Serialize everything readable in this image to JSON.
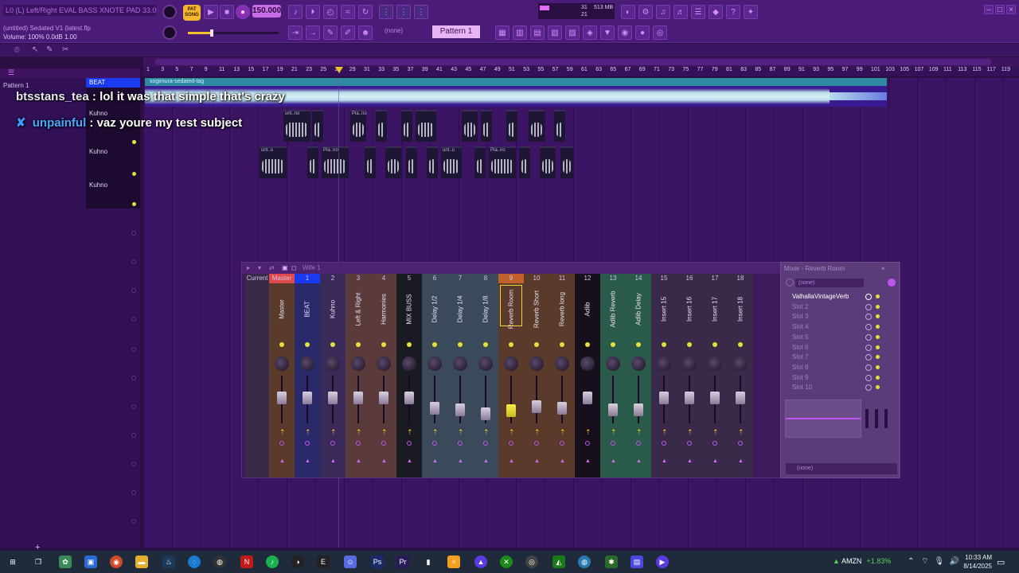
{
  "toolbar": {
    "hint": "L0 (L) Left/Right EVAL BASS XNOTE PAD 33.0",
    "song_mode": [
      "PAT",
      "SONG"
    ],
    "tempo": "150.000",
    "project_title": "(untitled) Sedated V1 (latest.flp",
    "volume_readout": "Volume: 100% 0.0dB 1.00",
    "pattern_selector": "Pattern 1",
    "channel_filter": "(none)",
    "cpu_value": "31",
    "ram_value": "513 MB",
    "second_value": "21"
  },
  "playlist": {
    "pattern_label": "Pattern 1",
    "timeline_ticks": [
      "1",
      "3",
      "5",
      "7",
      "9",
      "11",
      "13",
      "15",
      "17",
      "19",
      "21",
      "23",
      "25",
      "27",
      "29",
      "31",
      "33",
      "35",
      "37",
      "39",
      "41",
      "43",
      "45",
      "47",
      "49",
      "51",
      "53",
      "55",
      "57",
      "59",
      "61",
      "63",
      "65",
      "67",
      "69",
      "71",
      "73",
      "75",
      "77",
      "79",
      "81",
      "83",
      "85",
      "87",
      "89",
      "91",
      "93",
      "95",
      "97",
      "99",
      "101",
      "103",
      "105",
      "107",
      "109",
      "111",
      "113",
      "115",
      "117",
      "119"
    ],
    "tracks": [
      {
        "name": "BEAT"
      },
      {
        "name": "Kuhno"
      },
      {
        "name": "Kuhno"
      },
      {
        "name": "Kuhno"
      }
    ],
    "clip_main": "sogimura-sedated-tag",
    "small_clips_row1": [
      "unt..no",
      "Pia..no"
    ],
    "small_clips_row2": [
      "unt..o",
      "Pia..no",
      "unt..o",
      "Pia..no"
    ]
  },
  "chat": [
    {
      "user": "btsstans_tea",
      "message": "lol it was that simple that's crazy"
    },
    {
      "user": "unpainful",
      "message": "vaz youre my test subject"
    }
  ],
  "mixer": {
    "title": "Wife 1",
    "channels": [
      {
        "num": "Current",
        "name": "",
        "fader": 0.0
      },
      {
        "num": "Master",
        "name": "Master",
        "fader": 0.55
      },
      {
        "num": "1",
        "name": "BEAT",
        "fader": 0.55
      },
      {
        "num": "2",
        "name": "Kuhno",
        "fader": 0.55
      },
      {
        "num": "3",
        "name": "Left & Right",
        "fader": 0.55
      },
      {
        "num": "4",
        "name": "Harmonies",
        "fader": 0.55
      },
      {
        "num": "5",
        "name": "MIX BUSS",
        "fader": 0.55
      },
      {
        "num": "6",
        "name": "Delay 1/2",
        "fader": 0.25
      },
      {
        "num": "7",
        "name": "Delay 1/4",
        "fader": 0.2
      },
      {
        "num": "8",
        "name": "Delay 1/8",
        "fader": 0.1
      },
      {
        "num": "9",
        "name": "Reverb Room",
        "fader": 0.18
      },
      {
        "num": "10",
        "name": "Reverb Short",
        "fader": 0.3
      },
      {
        "num": "11",
        "name": "Reverb long",
        "fader": 0.25
      },
      {
        "num": "12",
        "name": "Adlib",
        "fader": 0.55
      },
      {
        "num": "13",
        "name": "Adlib Reverb",
        "fader": 0.2
      },
      {
        "num": "14",
        "name": "Adlib Delay",
        "fader": 0.2
      },
      {
        "num": "15",
        "name": "Insert 15",
        "fader": 0.55
      },
      {
        "num": "16",
        "name": "Insert 16",
        "fader": 0.55
      },
      {
        "num": "17",
        "name": "Insert 17",
        "fader": 0.55
      },
      {
        "num": "18",
        "name": "Insert 18",
        "fader": 0.55
      }
    ],
    "fx_panel": {
      "title": "Mixer - Reverb Room",
      "input": "(none)",
      "slots": [
        "ValhallaVintageVerb",
        "Slot 2",
        "Slot 3",
        "Slot 4",
        "Slot 5",
        "Slot 6",
        "Slot 7",
        "Slot 8",
        "Slot 9",
        "Slot 10"
      ],
      "output": "(none)"
    }
  },
  "taskbar": {
    "stock_symbol": "AMZN",
    "stock_change": "+1.83%",
    "time": "10:33 AM",
    "date": "8/14/2025"
  },
  "colors": {
    "accent": "#c96ce8",
    "beat_track": "#1a3af0",
    "led": "#e2e23a"
  }
}
